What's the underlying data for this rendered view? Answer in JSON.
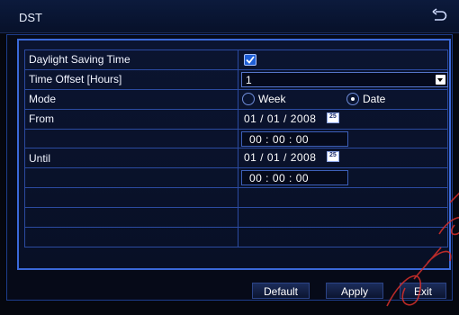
{
  "window": {
    "title": "DST",
    "back_icon": "back-arrow-icon"
  },
  "rows": {
    "dst": {
      "label": "Daylight Saving Time",
      "checked": true
    },
    "offset": {
      "label": "Time Offset [Hours]",
      "value": "1"
    },
    "mode": {
      "label": "Mode",
      "option_week": "Week",
      "option_date": "Date",
      "selected": "Date"
    },
    "from": {
      "label": "From",
      "date": "01 / 01 / 2008",
      "time": "00 : 00 : 00"
    },
    "until": {
      "label": "Until",
      "date": "01 / 01 / 2008",
      "time": "00 : 00 : 00"
    },
    "calendar_icon_text": "25"
  },
  "buttons": {
    "default": "Default",
    "apply": "Apply",
    "exit": "Exit"
  },
  "colors": {
    "accent": "#3b69d9",
    "background": "#05070f",
    "grid": "#2b4aa0"
  }
}
